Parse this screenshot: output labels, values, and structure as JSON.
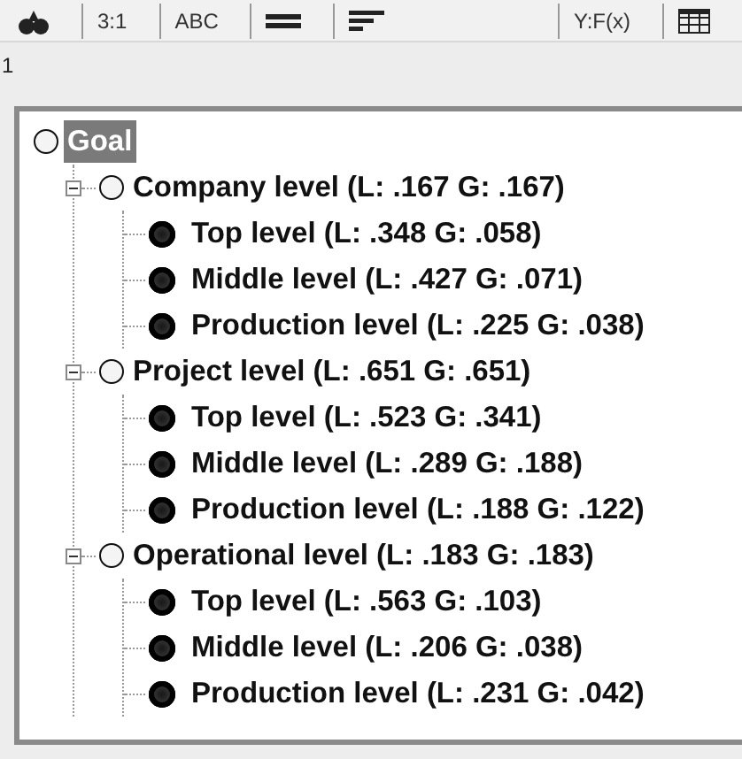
{
  "toolbar": {
    "tabs": [
      {
        "kind": "icon"
      },
      {
        "kind": "text",
        "label": "3:1"
      },
      {
        "kind": "text",
        "label": "ABC"
      },
      {
        "kind": "icon"
      },
      {
        "kind": "icon"
      },
      {
        "kind": "spacer"
      },
      {
        "kind": "text",
        "label": "Y:F(x)"
      },
      {
        "kind": "icon"
      }
    ]
  },
  "line_number": "1",
  "tree": {
    "label": "Goal",
    "kind": "goal",
    "selected": true,
    "children": [
      {
        "label": "Company level (L: .167 G: .167)",
        "kind": "criterion",
        "expanded": true,
        "selected": false,
        "children": [
          {
            "label": "Top level (L: .348 G: .058)",
            "kind": "alternative",
            "selected": false
          },
          {
            "label": "Middle level (L: .427 G: .071)",
            "kind": "alternative",
            "selected": false
          },
          {
            "label": "Production level (L: .225 G: .038)",
            "kind": "alternative",
            "selected": false
          }
        ]
      },
      {
        "label": "Project level (L: .651 G: .651)",
        "kind": "criterion",
        "expanded": true,
        "selected": false,
        "children": [
          {
            "label": "Top level (L: .523 G: .341)",
            "kind": "alternative",
            "selected": false
          },
          {
            "label": "Middle level (L: .289 G: .188)",
            "kind": "alternative",
            "selected": false
          },
          {
            "label": "Production level (L: .188 G: .122)",
            "kind": "alternative",
            "selected": false
          }
        ]
      },
      {
        "label": "Operational level (L: .183 G: .183)",
        "kind": "criterion",
        "expanded": true,
        "selected": false,
        "children": [
          {
            "label": "Top level (L: .563 G: .103)",
            "kind": "alternative",
            "selected": false
          },
          {
            "label": "Middle level (L: .206 G: .038)",
            "kind": "alternative",
            "selected": false
          },
          {
            "label": "Production level (L: .231 G: .042)",
            "kind": "alternative",
            "selected": false
          }
        ]
      }
    ]
  }
}
